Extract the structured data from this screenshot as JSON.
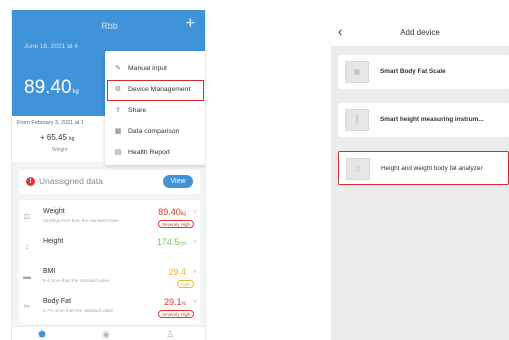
{
  "left": {
    "header": {
      "title": "Rbb",
      "plus": "+",
      "date_text": "June 16, 2021 at 4",
      "weight_value": "89.40",
      "weight_unit": "kg"
    },
    "summary": {
      "range_text": "From February 3, 2021 at 1",
      "change_value": "+ 65.45",
      "change_unit": "kg",
      "change_label": "Weight"
    },
    "dropdown": {
      "items": [
        {
          "icon": "manual-input-icon",
          "glyph": "✎",
          "label": "Manual input"
        },
        {
          "icon": "device-management-icon",
          "glyph": "⚙",
          "label": "Device Management"
        },
        {
          "icon": "share-icon",
          "glyph": "⇪",
          "label": "Share"
        },
        {
          "icon": "data-comparison-icon",
          "glyph": "▦",
          "label": "Data comparison"
        },
        {
          "icon": "health-report-icon",
          "glyph": "▤",
          "label": "Health Report"
        }
      ],
      "highlight_color": "#d8292c"
    },
    "unassigned": {
      "badge": "!",
      "text": "Unassigned data",
      "view_label": "View"
    },
    "metrics": [
      {
        "name": "Weight",
        "desc": "16.82kg more than the standard value",
        "value": "89.40",
        "unit": "kg",
        "badge": "Severely High",
        "color": "#e2352f",
        "icon": "weight-icon",
        "glyph": "⚖"
      },
      {
        "name": "Height",
        "desc": "",
        "value": "174.5",
        "unit": "cm",
        "badge": "",
        "color": "#7cc24f",
        "icon": "height-icon",
        "glyph": "↕"
      },
      {
        "name": "BMI",
        "desc": "6.4 more than the standard value",
        "value": "29.4",
        "unit": "",
        "badge": "High",
        "color": "#e8b923",
        "icon": "bmi-icon",
        "glyph": "▬"
      },
      {
        "name": "Body Fat",
        "desc": "8.7% more than the standard value",
        "value": "29.1",
        "unit": "%",
        "badge": "Severely High",
        "color": "#e2352f",
        "icon": "body-fat-icon",
        "glyph": "✂"
      }
    ],
    "tabbar": [
      {
        "icon": "home-shield-icon",
        "glyph": "⬟",
        "active": true
      },
      {
        "icon": "activity-icon",
        "glyph": "◉",
        "active": false
      },
      {
        "icon": "profile-icon",
        "glyph": "♙",
        "active": false
      }
    ],
    "colors": {
      "header": "#3f93d9",
      "active_tab": "#3f93d9"
    }
  },
  "right": {
    "header": {
      "back": "‹",
      "title": "Add device"
    },
    "devices": [
      {
        "name": "Smart Body Fat Scale",
        "icon": "body-fat-scale-icon",
        "glyph": "▣",
        "selected": false
      },
      {
        "name": "Smart height measuring instrum...",
        "icon": "height-instrument-icon",
        "glyph": "┃",
        "selected": false
      },
      {
        "name": "Height and weight body fat analyzer",
        "icon": "body-fat-analyzer-icon",
        "glyph": "▯",
        "selected": true
      }
    ]
  }
}
